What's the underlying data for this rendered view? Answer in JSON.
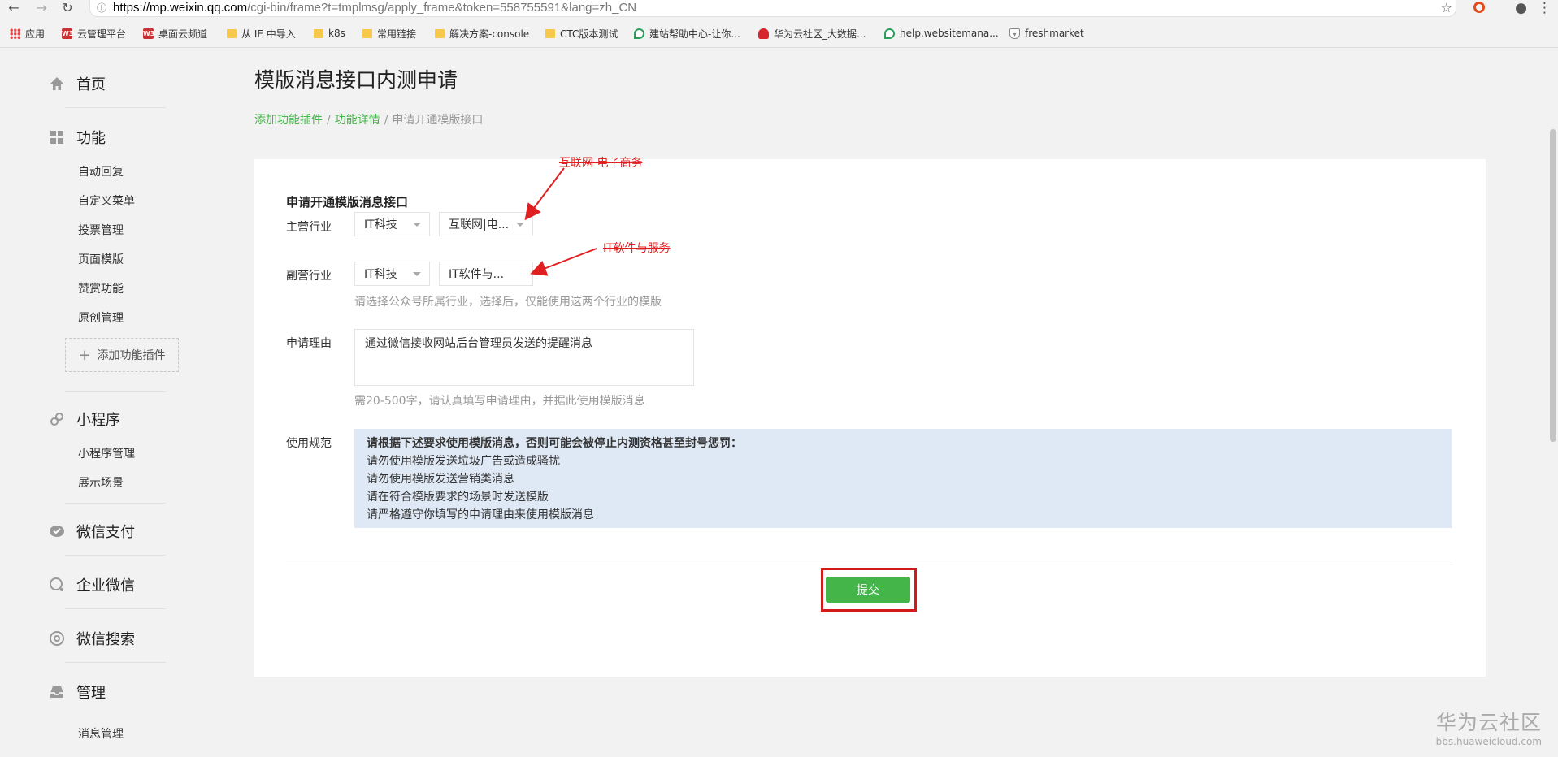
{
  "browser": {
    "url_host": "https://mp.weixin.qq.com",
    "url_path": "/cgi-bin/frame?t=tmplmsg/apply_frame&token=558755591&lang=zh_CN",
    "bookmarks": [
      "应用",
      "云管理平台",
      "桌面云频道",
      "从 IE 中导入",
      "k8s",
      "常用链接",
      "解决方案-console",
      "CTC版本测试",
      "建站帮助中心-让你...",
      "华为云社区_大数据...",
      "help.websitemana...",
      "freshmarket"
    ]
  },
  "sidebar": {
    "home": "首页",
    "features": "功能",
    "feature_items": [
      "自动回复",
      "自定义菜单",
      "投票管理",
      "页面模版",
      "赞赏功能",
      "原创管理"
    ],
    "add_plugin": "添加功能插件",
    "miniprogram": "小程序",
    "miniprogram_items": [
      "小程序管理",
      "展示场景"
    ],
    "wechat_pay": "微信支付",
    "wecom": "企业微信",
    "wechat_search": "微信搜索",
    "manage": "管理",
    "manage_items": [
      "消息管理"
    ]
  },
  "page": {
    "title": "模版消息接口内测申请",
    "breadcrumb": [
      "添加功能插件",
      "功能详情",
      "申请开通模版接口"
    ],
    "breadcrumb_sep": "/"
  },
  "form": {
    "title": "申请开通模版消息接口",
    "primary_label": "主营行业",
    "primary_select_1": "IT科技",
    "primary_select_2": "互联网|电...",
    "secondary_label": "副营行业",
    "secondary_select_1": "IT科技",
    "secondary_select_2": "IT软件与...",
    "industry_hint": "请选择公众号所属行业，选择后，仅能使用这两个行业的模版",
    "reason_label": "申请理由",
    "reason_value": "通过微信接收网站后台管理员发送的提醒消息",
    "reason_hint": "需20-500字，请认真填写申请理由，并据此使用模版消息",
    "rules_label": "使用规范",
    "rules_head": "请根据下述要求使用模版消息，否则可能会被停止内测资格甚至封号惩罚：",
    "rules": [
      "请勿使用模版发送垃圾广告或造成骚扰",
      "请勿使用模版发送营销类消息",
      "请在符合模版要求的场景时发送模版",
      "请严格遵守你填写的申请理由来使用模版消息"
    ],
    "submit": "提交"
  },
  "annotations": {
    "primary_note": "互联网 电子商务",
    "secondary_note": "IT软件与服务",
    "color": "#e02020"
  },
  "watermark": {
    "brand": "华为云社区",
    "url": "bbs.huaweicloud.com"
  },
  "colors": {
    "accent_green": "#44b549",
    "highlight_red": "#d21a1a",
    "rules_bg": "#dfe9f5"
  }
}
